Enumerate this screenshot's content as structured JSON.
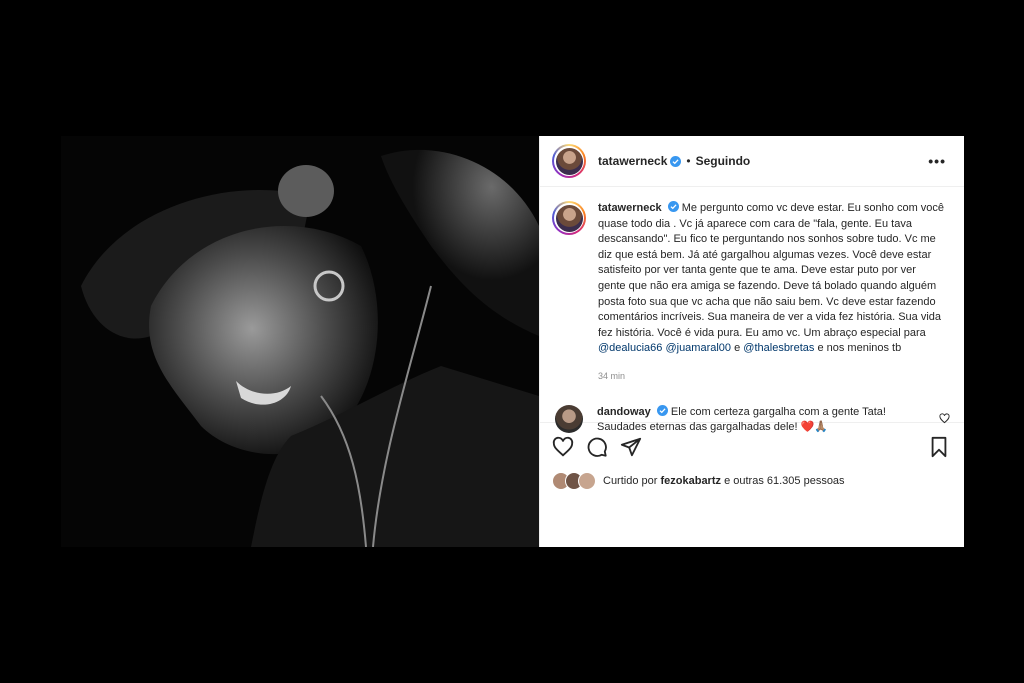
{
  "post": {
    "username": "tatawerneck",
    "dot": "•",
    "following": "Seguindo",
    "more": "•••"
  },
  "caption": {
    "username": "tatawerneck",
    "text": "Me pergunto como vc deve estar. Eu sonho com você quase todo dia . Vc já aparece com cara de \"fala, gente. Eu tava descansando\". Eu fico te perguntando nos sonhos sobre tudo. Vc me diz que está bem. Já até gargalhou algumas vezes. Você deve estar satisfeito por ver tanta gente que te ama. Deve estar puto por ver gente que não era amiga se fazendo. Deve tá bolado quando alguém posta foto sua que vc acha que não saiu bem. Vc deve estar fazendo comentários incríveis. Sua maneira de ver a vida fez história. Sua vida fez história. Você é vida pura. Eu amo vc. Um abraço especial para",
    "mention1": "@dealucia66",
    "mention2": "@juamaral00",
    "conj": "e",
    "mention3": "@thalesbretas",
    "tail": "e nos meninos tb",
    "time": "34 min"
  },
  "comment": {
    "username": "dandoway",
    "text": "Ele com certeza gargalha com a gente Tata! Saudades eternas das gargalhadas dele!",
    "emoji": "❤️🙏🏽"
  },
  "likes": {
    "prefix": "Curtido por",
    "user": "fezokabartz",
    "suffix": "e outras 61.305 pessoas"
  },
  "icons": {
    "header": [
      "verified-icon",
      "more-icon"
    ],
    "actions": [
      "heart-icon",
      "comment-icon",
      "share-icon",
      "bookmark-icon"
    ]
  },
  "colors": {
    "verified": "#3897f0",
    "mention": "#00376b",
    "secondary": "#8e8e8e"
  }
}
